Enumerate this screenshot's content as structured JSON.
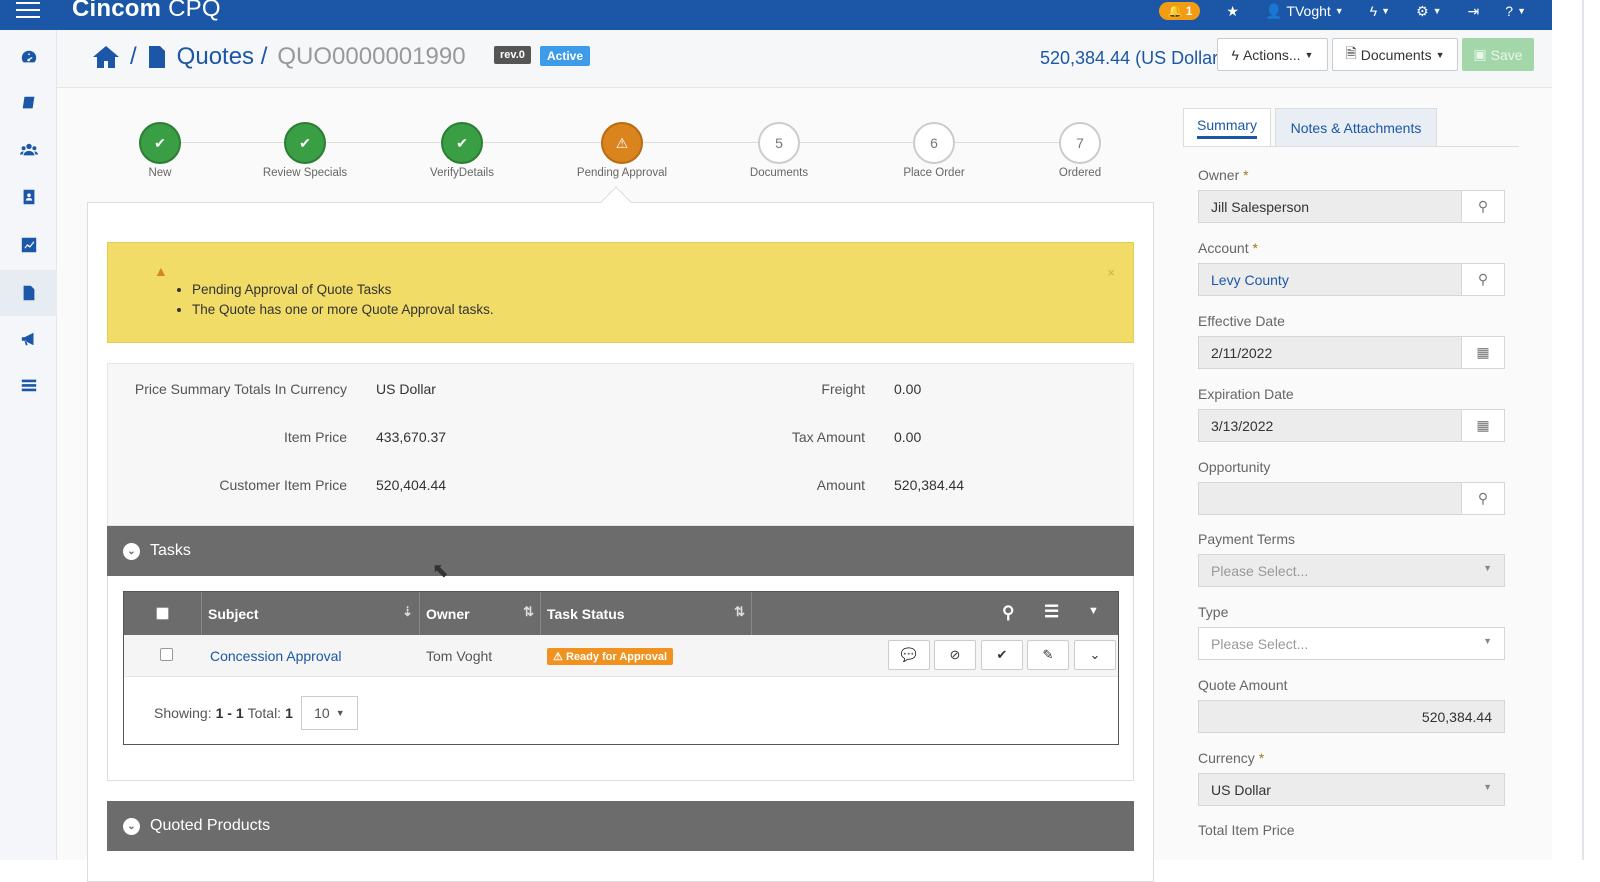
{
  "app": {
    "brand": "Cincom",
    "brand_suffix": "CPQ",
    "notifications_count": "1",
    "user_name": "TVoght"
  },
  "breadcrumb": {
    "section": "Quotes /",
    "quote_id": "QUO0000001990",
    "revision": "rev.0",
    "status": "Active"
  },
  "header": {
    "total_amount": "520,384.44 (US Dollar)",
    "actions_label": "Actions...",
    "documents_label": "Documents",
    "save_label": "Save"
  },
  "stepper": {
    "steps": [
      {
        "label": "New",
        "state": "done",
        "number": ""
      },
      {
        "label": "Review Specials",
        "state": "done",
        "number": ""
      },
      {
        "label": "VerifyDetails",
        "state": "done",
        "number": ""
      },
      {
        "label": "Pending Approval",
        "state": "current",
        "number": ""
      },
      {
        "label": "Documents",
        "state": "todo",
        "number": "5"
      },
      {
        "label": "Place Order",
        "state": "todo",
        "number": "6"
      },
      {
        "label": "Ordered",
        "state": "todo",
        "number": "7"
      }
    ]
  },
  "alert": {
    "lines": [
      "Pending Approval of Quote Tasks",
      "The Quote has one or more Quote Approval tasks."
    ],
    "close": "×"
  },
  "price_summary": {
    "currency_label": "Price Summary Totals In Currency",
    "currency_value": "US Dollar",
    "item_price_label": "Item Price",
    "item_price_value": "433,670.37",
    "customer_item_price_label": "Customer Item Price",
    "customer_item_price_value": "520,404.44",
    "freight_label": "Freight",
    "freight_value": "0.00",
    "tax_label": "Tax Amount",
    "tax_value": "0.00",
    "amount_label": "Amount",
    "amount_value": "520,384.44"
  },
  "tasks": {
    "title": "Tasks",
    "columns": [
      "Subject",
      "Owner",
      "Task Status"
    ],
    "rows": [
      {
        "subject": "Concession Approval",
        "owner": "Tom Voght",
        "status": "Ready for Approval"
      }
    ],
    "pager": {
      "showing_label": "Showing:",
      "range": "1 - 1",
      "total_label": "Total:",
      "total": "1",
      "page_size": "10"
    }
  },
  "quoted_products": {
    "title": "Quoted Products"
  },
  "right_panel": {
    "tabs": [
      "Summary",
      "Notes & Attachments"
    ],
    "owner_label": "Owner",
    "owner_value": "Jill Salesperson",
    "account_label": "Account",
    "account_value": "Levy County",
    "effective_label": "Effective Date",
    "effective_value": "2/11/2022",
    "expiration_label": "Expiration Date",
    "expiration_value": "3/13/2022",
    "opportunity_label": "Opportunity",
    "opportunity_value": "",
    "payment_terms_label": "Payment Terms",
    "payment_terms_placeholder": "Please Select...",
    "type_label": "Type",
    "type_placeholder": "Please Select...",
    "quote_amount_label": "Quote Amount",
    "quote_amount_value": "520,384.44",
    "currency_label": "Currency",
    "currency_value": "US Dollar",
    "total_item_price_label": "Total Item Price",
    "required_mark": "*"
  },
  "colors": {
    "brand_blue": "#1b57a6",
    "done_green": "#3a9e45",
    "warn_orange": "#d9841d",
    "alert_yellow": "#f0dc67",
    "status_orange": "#f0921f"
  }
}
